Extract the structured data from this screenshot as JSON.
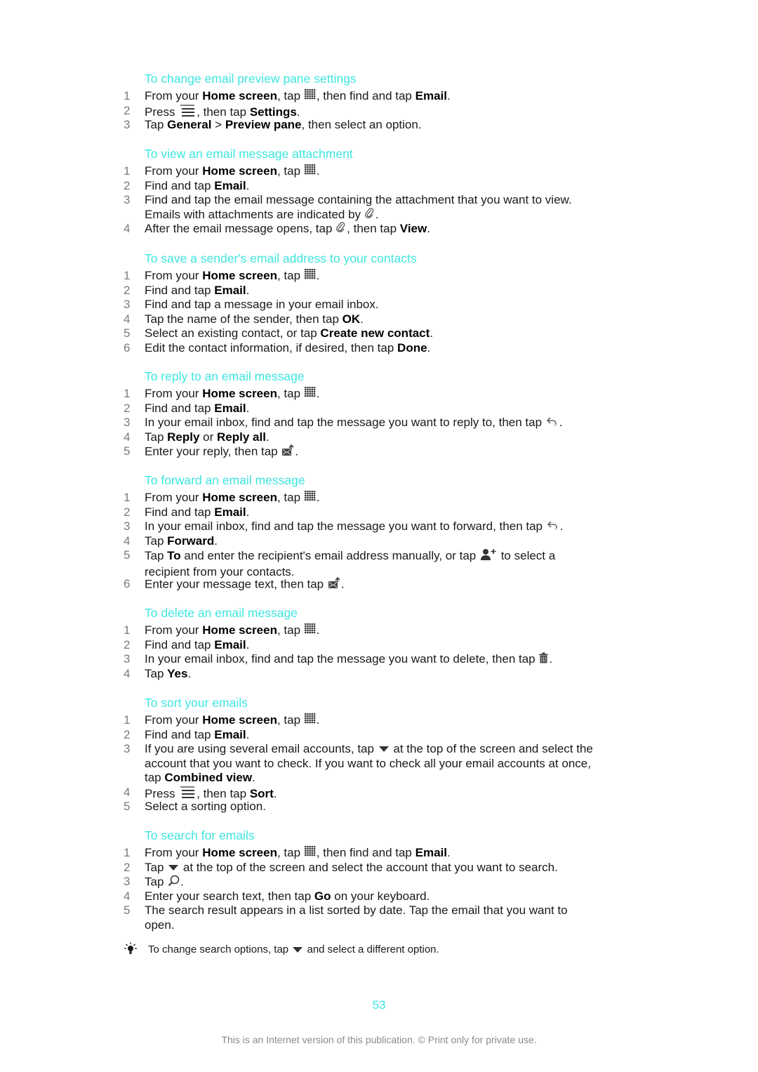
{
  "sections": [
    {
      "heading": "To change email preview pane settings",
      "steps": [
        {
          "n": "1",
          "parts": [
            "From your ",
            {
              "b": "Home screen"
            },
            ", tap ",
            {
              "icon": "apps-grid-icon"
            },
            ", then find and tap ",
            {
              "b": "Email"
            },
            "."
          ]
        },
        {
          "n": "2",
          "parts": [
            "Press ",
            {
              "icon": "menu-icon"
            },
            ", then tap ",
            {
              "b": "Settings"
            },
            "."
          ]
        },
        {
          "n": "3",
          "parts": [
            "Tap ",
            {
              "b": "General"
            },
            " > ",
            {
              "b": "Preview pane"
            },
            ", then select an option."
          ]
        }
      ]
    },
    {
      "heading": "To view an email message attachment",
      "steps": [
        {
          "n": "1",
          "parts": [
            "From your ",
            {
              "b": "Home screen"
            },
            ", tap ",
            {
              "icon": "apps-grid-icon"
            },
            "."
          ]
        },
        {
          "n": "2",
          "parts": [
            "Find and tap ",
            {
              "b": "Email"
            },
            "."
          ]
        },
        {
          "n": "3",
          "two_line": true,
          "parts": [
            "Find and tap the email message containing the attachment that you want to view. Emails with attachments are indicated by ",
            {
              "icon": "paperclip-icon"
            },
            "."
          ]
        },
        {
          "n": "4",
          "parts": [
            "After the email message opens, tap ",
            {
              "icon": "paperclip-icon"
            },
            ", then tap ",
            {
              "b": "View"
            },
            "."
          ]
        }
      ]
    },
    {
      "heading": "To save a sender's email address to your contacts",
      "steps": [
        {
          "n": "1",
          "parts": [
            "From your ",
            {
              "b": "Home screen"
            },
            ", tap ",
            {
              "icon": "apps-grid-icon"
            },
            "."
          ]
        },
        {
          "n": "2",
          "parts": [
            "Find and tap ",
            {
              "b": "Email"
            },
            "."
          ]
        },
        {
          "n": "3",
          "parts": [
            "Find and tap a message in your email inbox."
          ]
        },
        {
          "n": "4",
          "parts": [
            "Tap the name of the sender, then tap ",
            {
              "b": "OK"
            },
            "."
          ]
        },
        {
          "n": "5",
          "parts": [
            "Select an existing contact, or tap ",
            {
              "b": "Create new contact"
            },
            "."
          ]
        },
        {
          "n": "6",
          "parts": [
            "Edit the contact information, if desired, then tap ",
            {
              "b": "Done"
            },
            "."
          ]
        }
      ]
    },
    {
      "heading": "To reply to an email message",
      "steps": [
        {
          "n": "1",
          "parts": [
            "From your ",
            {
              "b": "Home screen"
            },
            ", tap ",
            {
              "icon": "apps-grid-icon"
            },
            "."
          ]
        },
        {
          "n": "2",
          "parts": [
            "Find and tap ",
            {
              "b": "Email"
            },
            "."
          ]
        },
        {
          "n": "3",
          "parts": [
            "In your email inbox, find and tap the message you want to reply to, then tap ",
            {
              "icon": "reply-icon"
            },
            "."
          ]
        },
        {
          "n": "4",
          "parts": [
            "Tap ",
            {
              "b": "Reply"
            },
            " or ",
            {
              "b": "Reply all"
            },
            "."
          ]
        },
        {
          "n": "5",
          "parts": [
            "Enter your reply, then tap ",
            {
              "icon": "send-mail-icon"
            },
            "."
          ]
        }
      ]
    },
    {
      "heading": "To forward an email message",
      "steps": [
        {
          "n": "1",
          "parts": [
            "From your ",
            {
              "b": "Home screen"
            },
            ", tap ",
            {
              "icon": "apps-grid-icon"
            },
            "."
          ]
        },
        {
          "n": "2",
          "parts": [
            "Find and tap ",
            {
              "b": "Email"
            },
            "."
          ]
        },
        {
          "n": "3",
          "parts": [
            "In your email inbox, find and tap the message you want to forward, then tap ",
            {
              "icon": "reply-icon"
            },
            "."
          ]
        },
        {
          "n": "4",
          "parts": [
            "Tap ",
            {
              "b": "Forward"
            },
            "."
          ]
        },
        {
          "n": "5",
          "two_line": true,
          "parts": [
            "Tap ",
            {
              "b": "To"
            },
            " and enter the recipient's email address manually, or tap ",
            {
              "icon": "add-contact-icon"
            },
            " to select a recipient from your contacts."
          ]
        },
        {
          "n": "6",
          "parts": [
            "Enter your message text, then tap ",
            {
              "icon": "send-mail-icon"
            },
            "."
          ]
        }
      ]
    },
    {
      "heading": "To delete an email message",
      "steps": [
        {
          "n": "1",
          "parts": [
            "From your ",
            {
              "b": "Home screen"
            },
            ", tap ",
            {
              "icon": "apps-grid-icon"
            },
            "."
          ]
        },
        {
          "n": "2",
          "parts": [
            "Find and tap ",
            {
              "b": "Email"
            },
            "."
          ]
        },
        {
          "n": "3",
          "parts": [
            "In your email inbox, find and tap the message you want to delete, then tap ",
            {
              "icon": "trash-icon"
            },
            "."
          ]
        },
        {
          "n": "4",
          "parts": [
            "Tap ",
            {
              "b": "Yes"
            },
            "."
          ]
        }
      ]
    },
    {
      "heading": "To sort your emails",
      "steps": [
        {
          "n": "1",
          "parts": [
            "From your ",
            {
              "b": "Home screen"
            },
            ", tap ",
            {
              "icon": "apps-grid-icon"
            },
            "."
          ]
        },
        {
          "n": "2",
          "parts": [
            "Find and tap ",
            {
              "b": "Email"
            },
            "."
          ]
        },
        {
          "n": "3",
          "three_line": true,
          "parts": [
            "If you are using several email accounts, tap ",
            {
              "icon": "dropdown-triangle-icon"
            },
            " at the top of the screen and select the account that you want to check. If you want to check all your email accounts at once, tap ",
            {
              "b": "Combined view"
            },
            "."
          ]
        },
        {
          "n": "4",
          "parts": [
            "Press ",
            {
              "icon": "menu-icon"
            },
            ", then tap ",
            {
              "b": "Sort"
            },
            "."
          ]
        },
        {
          "n": "5",
          "parts": [
            "Select a sorting option."
          ]
        }
      ]
    },
    {
      "heading": "To search for emails",
      "steps": [
        {
          "n": "1",
          "parts": [
            "From your ",
            {
              "b": "Home screen"
            },
            ", tap ",
            {
              "icon": "apps-grid-icon"
            },
            ", then find and tap ",
            {
              "b": "Email"
            },
            "."
          ]
        },
        {
          "n": "2",
          "parts": [
            "Tap ",
            {
              "icon": "dropdown-triangle-icon"
            },
            " at the top of the screen and select the account that you want to search."
          ]
        },
        {
          "n": "3",
          "parts": [
            "Tap ",
            {
              "icon": "search-icon"
            },
            "."
          ]
        },
        {
          "n": "4",
          "parts": [
            "Enter your search text, then tap ",
            {
              "b": "Go"
            },
            " on your keyboard."
          ]
        },
        {
          "n": "5",
          "two_line": true,
          "parts": [
            "The search result appears in a list sorted by date. Tap the email that you want to open."
          ]
        }
      ]
    }
  ],
  "tip": {
    "icon": "lightbulb-tip-icon",
    "parts": [
      "To change search options, tap ",
      {
        "icon": "dropdown-triangle-icon"
      },
      " and select a different option."
    ]
  },
  "page_number": "53",
  "footer": "This is an Internet version of this publication. © Print only for private use.",
  "colors": {
    "heading": "#3ee6e0",
    "page_number": "#3ee6e0",
    "step_number": "#7a7a7a",
    "footer": "#8a8a8a"
  }
}
